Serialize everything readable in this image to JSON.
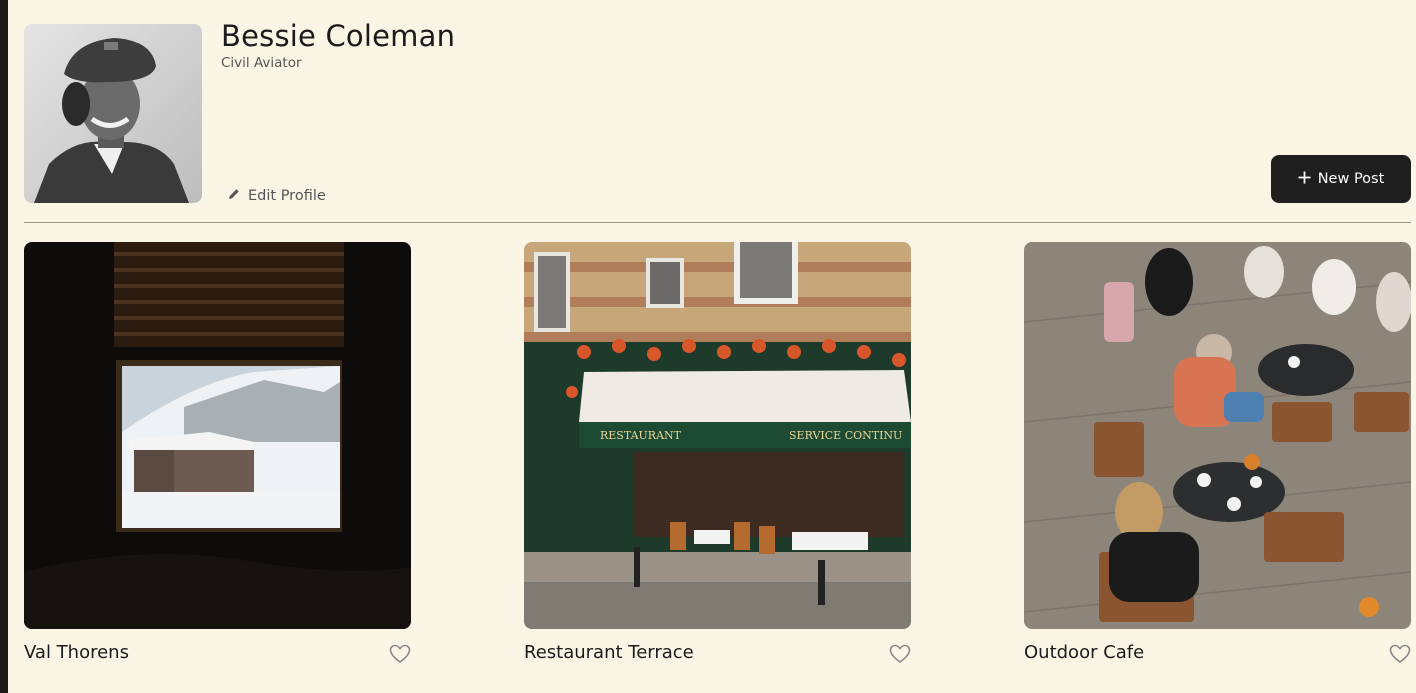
{
  "profile": {
    "name": "Bessie Coleman",
    "description": "Civil Aviator",
    "avatar_alt": "Portrait of Bessie Coleman"
  },
  "actions": {
    "edit_profile_label": "Edit Profile",
    "new_post_label": "New Post",
    "edit_icon": "pencil-icon",
    "new_post_icon": "plus-icon"
  },
  "cards": [
    {
      "title": "Val Thorens",
      "image_alt": "Val Thorens",
      "like_icon": "heart-icon",
      "liked": false
    },
    {
      "title": "Restaurant Terrace",
      "image_alt": "Restaurant Terrace",
      "like_icon": "heart-icon",
      "liked": false
    },
    {
      "title": "Outdoor Cafe",
      "image_alt": "Outdoor Cafe",
      "like_icon": "heart-icon",
      "liked": false
    }
  ],
  "colors": {
    "page_background": "#fbf5e6",
    "button_dark": "#1f1f1f",
    "text_primary": "#1b1b1b",
    "text_secondary": "#555555",
    "divider": "#9b9589"
  }
}
